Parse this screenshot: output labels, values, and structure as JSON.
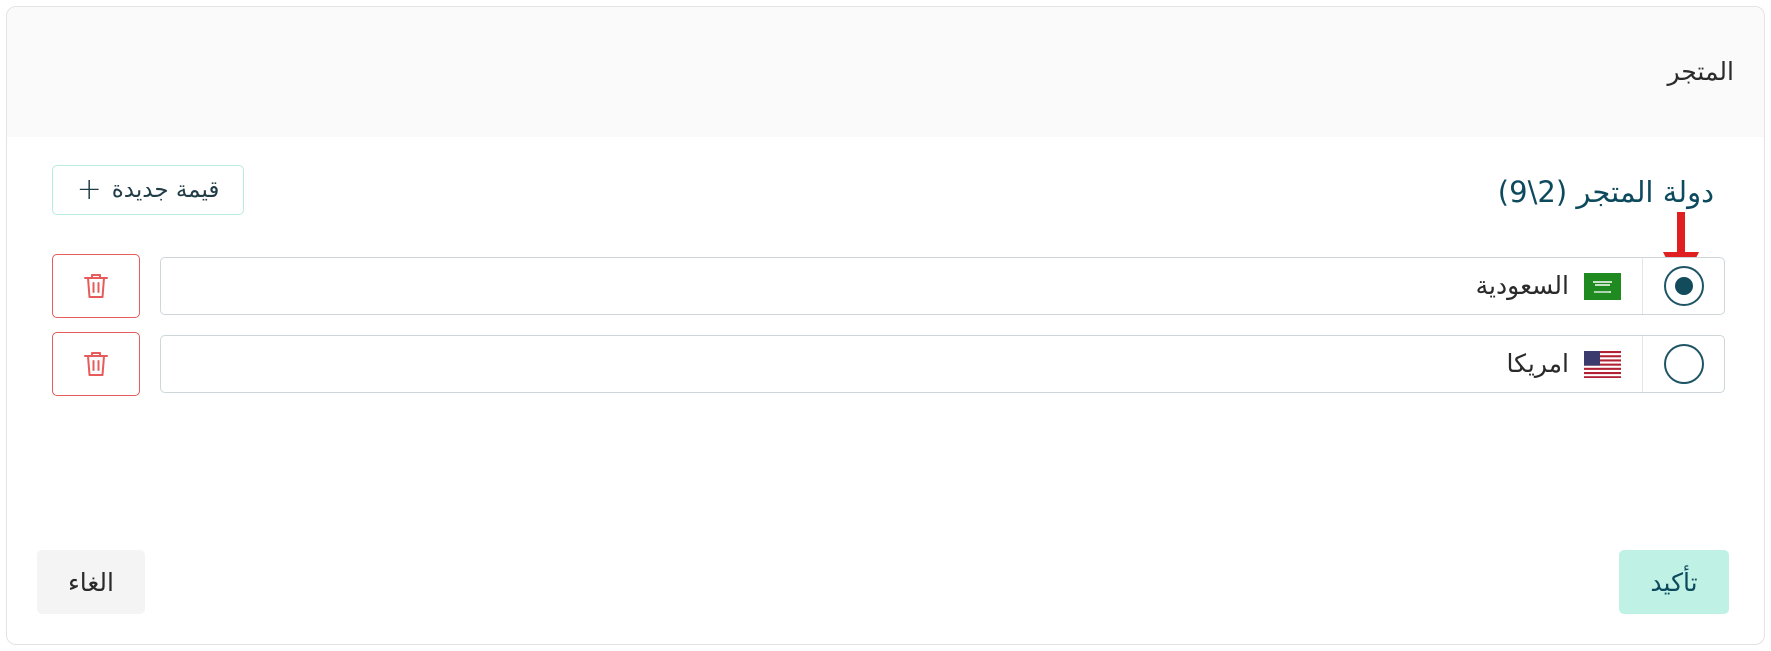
{
  "dialog": {
    "title": "المتجر"
  },
  "section": {
    "title": "دولة المتجر (2\\9)",
    "new_value_label": "قيمة جديدة",
    "new_value_icon": "plus-icon"
  },
  "options": [
    {
      "label": "السعودية",
      "flag": "saudi-flag-icon",
      "selected": true
    },
    {
      "label": "امريكا",
      "flag": "usa-flag-icon",
      "selected": false
    }
  ],
  "footer": {
    "confirm_label": "تأكيد",
    "cancel_label": "الغاء"
  },
  "colors": {
    "accent": "#0e4a5e",
    "confirm_bg": "#bff2e5",
    "delete": "#e85b5b",
    "annotation_arrow": "#e02020"
  }
}
